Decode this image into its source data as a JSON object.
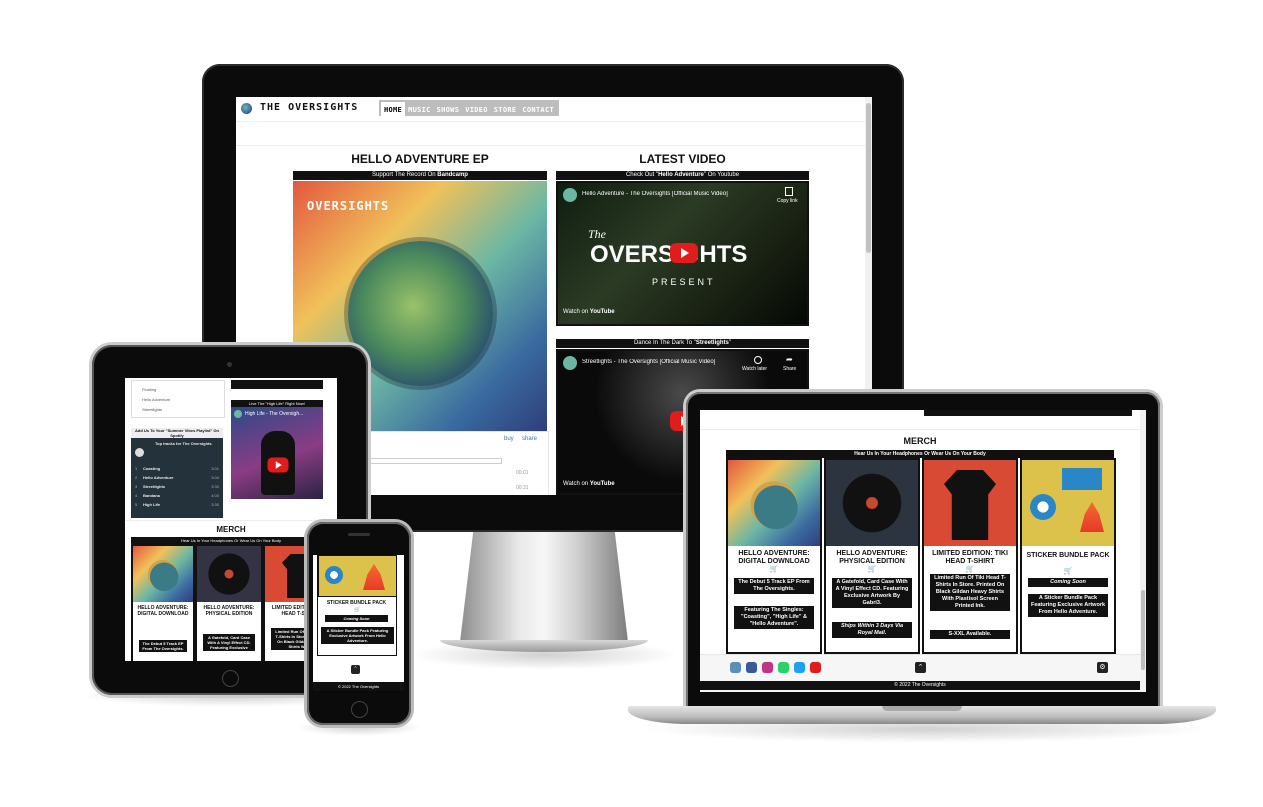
{
  "site": {
    "brand": "THE OVERSIGHTS",
    "nav": [
      "HOME",
      "MUSIC",
      "SHOWS",
      "VIDEO",
      "STORE",
      "CONTACT"
    ],
    "active_nav": "HOME"
  },
  "desktop": {
    "ep_heading": "HELLO ADVENTURE EP",
    "ep_caption_pre": "Support The Record On ",
    "ep_caption_bold": "Bandcamp",
    "player_buy": "buy",
    "player_share": "share",
    "player_times": [
      "00:01",
      "00:31"
    ],
    "video_heading": "LATEST VIDEO",
    "video1_caption_pre": "Check Out \"",
    "video1_caption_bold": "Hello Adventure",
    "video1_caption_post": "\" On Youtube",
    "video1_title": "Hello Adventure - The Oversights [Official Music Video]",
    "video1_copy": "Copy link",
    "video1_overlay_the": "The",
    "video1_overlay_band": "OVERSIGHTS",
    "video1_overlay_present": "PRESENT",
    "watch_on": "Watch on",
    "youtube": "YouTube",
    "video2_caption_pre": "Dance In The Dark To \"",
    "video2_caption_bold": "Streetlights",
    "video2_caption_post": "\"",
    "video2_title": "Streetlights - The Oversights [Official Music Video]",
    "video2_watch_later": "Watch later",
    "video2_share": "Share"
  },
  "tablet": {
    "tracklist_small": [
      "Floating",
      "Hello Adventure",
      "Streetlights"
    ],
    "live_caption": "Live The \"High Life\" Right Now!",
    "live_video_title": "High Life - The Oversigh...",
    "spotify_caption": "Add Us To Your \"Summer Vibes Playlist\" On Spotify",
    "spotify_title": "Top tracks for The Oversights",
    "spotify_tracks": [
      {
        "n": "1",
        "name": "Coasting",
        "t": "3:01"
      },
      {
        "n": "2",
        "name": "Hello Adventure",
        "t": "3:04"
      },
      {
        "n": "3",
        "name": "Streetlights",
        "t": "3:30"
      },
      {
        "n": "4",
        "name": "Bandana",
        "t": "4:00"
      },
      {
        "n": "5",
        "name": "High Life",
        "t": "3:30"
      }
    ],
    "merch_heading": "MERCH",
    "merch_caption": "Hear Us In Your Headphones Or Wear Us On Your Body",
    "cards": [
      {
        "title": "HELLO ADVENTURE: DIGITAL DOWNLOAD",
        "desc": "The Debut 5 Track EP From The Oversights."
      },
      {
        "title": "HELLO ADVENTURE: PHYSICAL EDITION",
        "desc": "A Gatefold, Card Case With A Vinyl Effect CD. Featuring Exclusive"
      },
      {
        "title": "LIMITED EDITION: TIKI HEAD T-SHIRT",
        "desc": "Limited Run Of Tiki Head T-Shirts In Store. Printed On Black Gildan Heavy Shirts With"
      }
    ]
  },
  "phone": {
    "card_title": "STICKER BUNDLE PACK",
    "card_tag": "Coming Soon",
    "card_desc": "A Sticker Bundle Pack Featuring Exclusive Artwork From Hello Adventure.",
    "footer": "© 2022 The Oversights"
  },
  "laptop": {
    "merch_heading": "MERCH",
    "merch_caption": "Hear Us In Your Headphones Or Wear Us On Your Body",
    "cards": [
      {
        "title": "HELLO ADVENTURE: DIGITAL DOWNLOAD",
        "badges": [
          "The Debut 5 Track EP From The Oversights.",
          "Featuring The Singles: \"Coasting\", \"High Life\" & \"Hello Adventure\"."
        ]
      },
      {
        "title": "HELLO ADVENTURE: PHYSICAL EDITION",
        "badges": [
          "A Gatefold, Card Case With A Vinyl Effect CD. Featuring Exclusive Artwork By Gabri3.",
          "Ships Within 3 Days Via Royal Mail."
        ]
      },
      {
        "title": "LIMITED EDITION: TIKI HEAD T-SHIRT",
        "badges": [
          "Limited Run Of Tiki Head T-Shirts In Store. Printed On Black Gildan Heavy Shirts With Plastisol Screen Printed Ink.",
          "S-XXL Available."
        ]
      },
      {
        "title": "STICKER BUNDLE PACK",
        "badges": [
          "Coming Soon",
          "A Sticker Bundle Pack Featuring Exclusive Artwork From Hello Adventure."
        ]
      }
    ],
    "footer": "© 2022 The Oversights",
    "social_colors": [
      "#5a8fb8",
      "#3b5998",
      "#c13584",
      "#25d366",
      "#1da1f2",
      "#e21b1b"
    ]
  }
}
